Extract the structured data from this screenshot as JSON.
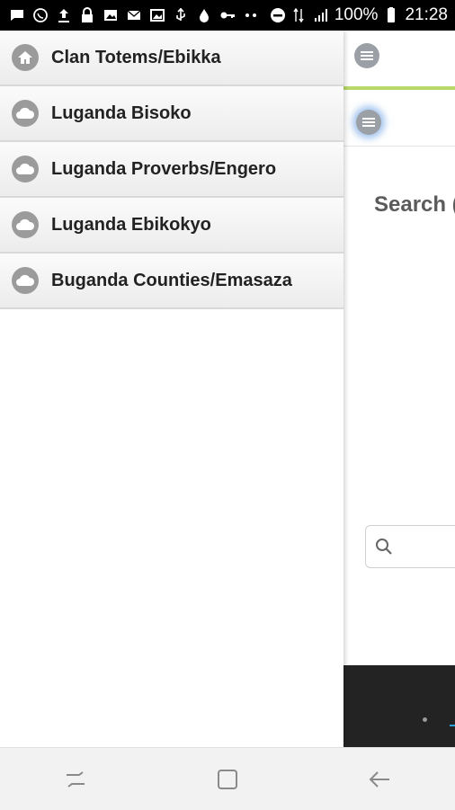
{
  "status_bar": {
    "battery": "100%",
    "time": "21:28"
  },
  "drawer": {
    "items": [
      {
        "label": "Clan Totems/Ebikka",
        "icon": "home-icon"
      },
      {
        "label": "Luganda Bisoko",
        "icon": "cloud-icon"
      },
      {
        "label": "Luganda Proverbs/Engero",
        "icon": "cloud-icon"
      },
      {
        "label": "Luganda Ebikokyo",
        "icon": "cloud-icon"
      },
      {
        "label": "Buganda Counties/Emasaza",
        "icon": "cloud-icon"
      }
    ]
  },
  "page": {
    "search_heading": "Search (",
    "search_input": {
      "placeholder": ""
    }
  },
  "colors": {
    "header_accent": "#b9d86a",
    "icon_gray": "#9b9b9b",
    "footer_bg": "#232323",
    "link_blue": "#2aa0d8"
  }
}
